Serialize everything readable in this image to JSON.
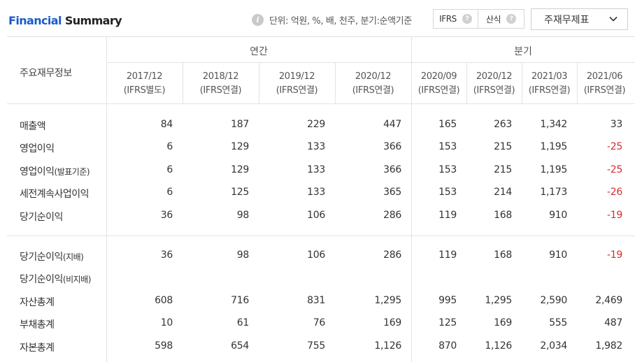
{
  "header": {
    "title_accent": "Financial",
    "title_rest": " Summary",
    "unit_text": "단위: 억원, %, 배, 천주, 분기:순액기준",
    "toggle_ifrs": "IFRS",
    "toggle_calc": "산식",
    "select_value": "주재무제표"
  },
  "table": {
    "corner": "주요재무정보",
    "group_annual": "연간",
    "group_quarter": "분기",
    "columns": [
      {
        "period": "2017/12",
        "basis": "(IFRS별도)"
      },
      {
        "period": "2018/12",
        "basis": "(IFRS연결)"
      },
      {
        "period": "2019/12",
        "basis": "(IFRS연결)"
      },
      {
        "period": "2020/12",
        "basis": "(IFRS연결)"
      },
      {
        "period": "2020/09",
        "basis": "(IFRS연결)"
      },
      {
        "period": "2020/12",
        "basis": "(IFRS연결)"
      },
      {
        "period": "2021/03",
        "basis": "(IFRS연결)"
      },
      {
        "period": "2021/06",
        "basis": "(IFRS연결)"
      }
    ],
    "rows": [
      {
        "label": "매출액",
        "sub": "",
        "values": [
          "84",
          "187",
          "229",
          "447",
          "165",
          "263",
          "1,342",
          "33"
        ]
      },
      {
        "label": "영업이익",
        "sub": "",
        "values": [
          "6",
          "129",
          "133",
          "366",
          "153",
          "215",
          "1,195",
          "-25"
        ]
      },
      {
        "label": "영업이익",
        "sub": "(발표기준)",
        "values": [
          "6",
          "129",
          "133",
          "366",
          "153",
          "215",
          "1,195",
          "-25"
        ]
      },
      {
        "label": "세전계속사업이익",
        "sub": "",
        "values": [
          "6",
          "125",
          "133",
          "365",
          "153",
          "214",
          "1,173",
          "-26"
        ]
      },
      {
        "label": "당기순이익",
        "sub": "",
        "values": [
          "36",
          "98",
          "106",
          "286",
          "119",
          "168",
          "910",
          "-19"
        ]
      },
      {
        "label": "당기순이익",
        "sub": "(지배)",
        "values": [
          "36",
          "98",
          "106",
          "286",
          "119",
          "168",
          "910",
          "-19"
        ]
      },
      {
        "label": "당기순이익",
        "sub": "(비지배)",
        "values": [
          "",
          "",
          "",
          "",
          "",
          "",
          "",
          ""
        ]
      },
      {
        "label": "자산총계",
        "sub": "",
        "values": [
          "608",
          "716",
          "831",
          "1,295",
          "995",
          "1,295",
          "2,590",
          "2,469"
        ]
      },
      {
        "label": "부채총계",
        "sub": "",
        "values": [
          "10",
          "61",
          "76",
          "169",
          "125",
          "169",
          "555",
          "487"
        ]
      },
      {
        "label": "자본총계",
        "sub": "",
        "values": [
          "598",
          "654",
          "755",
          "1,126",
          "870",
          "1,126",
          "2,034",
          "1,982"
        ]
      }
    ]
  }
}
